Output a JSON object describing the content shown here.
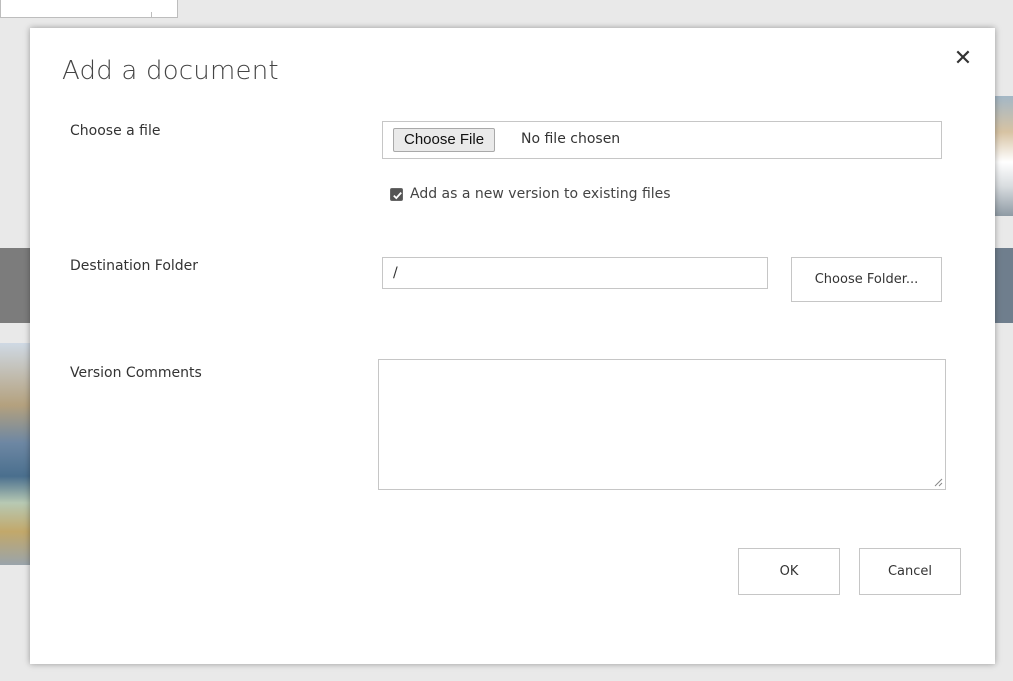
{
  "dialog": {
    "title": "Add a document",
    "close_glyph": "✕",
    "close_icon": "close-icon"
  },
  "file": {
    "label": "Choose a file",
    "button_label": "Choose File",
    "status": "No file chosen",
    "new_version_label": "Add as a new version to existing files",
    "new_version_checked": true
  },
  "destination": {
    "label": "Destination Folder",
    "value": "/",
    "choose_label": "Choose Folder..."
  },
  "comments": {
    "label": "Version Comments",
    "value": ""
  },
  "actions": {
    "ok_label": "OK",
    "cancel_label": "Cancel"
  }
}
